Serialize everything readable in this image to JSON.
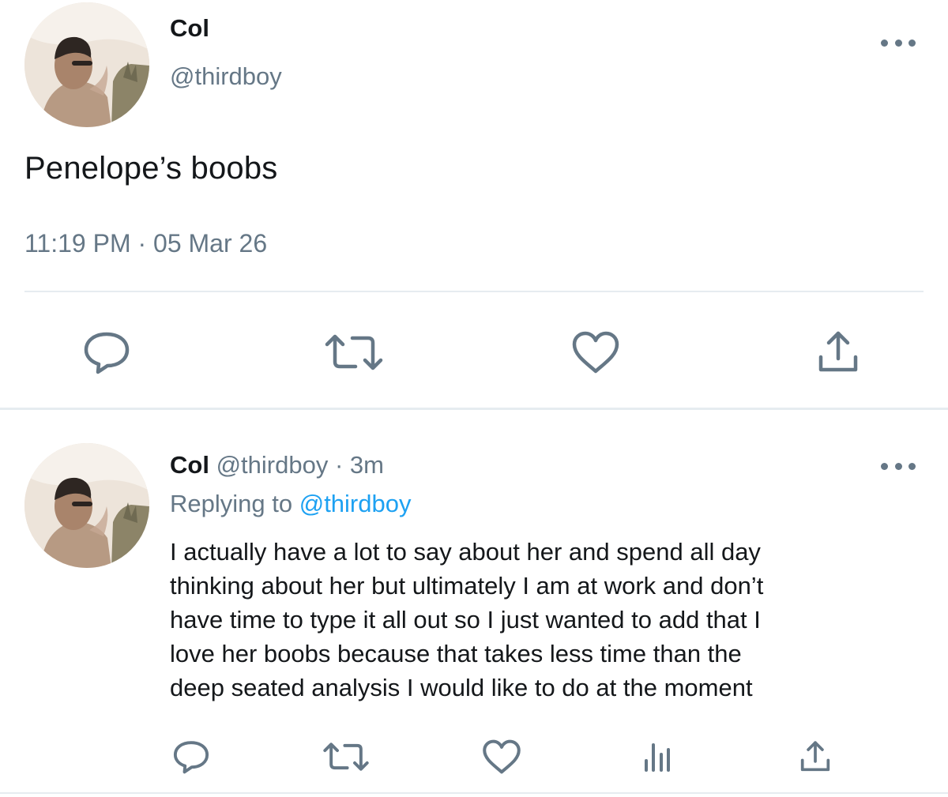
{
  "main_tweet": {
    "author": {
      "display_name": "Col",
      "handle": "@thirdboy",
      "avatar_icon": "profile-photo"
    },
    "text": "Penelope’s boobs",
    "timestamp": "11:19 PM · 05 Mar 26",
    "actions": [
      "reply-icon",
      "retweet-icon",
      "like-icon",
      "share-icon"
    ]
  },
  "reply": {
    "author": {
      "display_name": "Col",
      "handle": "@thirdboy",
      "avatar_icon": "profile-photo"
    },
    "time_ago": "· 3m",
    "replying_prefix": "Replying to",
    "replying_to": "@thirdboy",
    "text_lines": [
      "I actually have a lot to say about her and spend all day",
      "thinking about her but ultimately I am at work and don’t",
      "have time to type it all out so I just wanted to add that I",
      "love her boobs because that takes less time than the",
      "deep seated analysis I would like to do at the moment"
    ],
    "actions": [
      "reply-icon",
      "retweet-icon",
      "like-icon",
      "analytics-icon",
      "share-icon"
    ]
  },
  "colors": {
    "text": "#14171a",
    "secondary": "#657786",
    "link": "#1da1f2",
    "divider": "#e6ecf0"
  }
}
